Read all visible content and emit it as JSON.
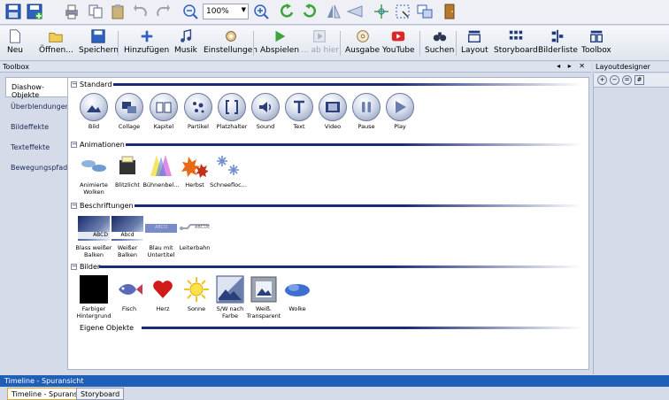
{
  "zoom_value": "100%",
  "toolbar": {
    "items": [
      {
        "label": "Neu",
        "icon": "new-document-icon"
      },
      {
        "label": "Öffnen...",
        "icon": "open-folder-icon"
      },
      {
        "label": "Speichern",
        "icon": "save-icon"
      },
      {
        "label": "Hinzufügen",
        "icon": "add-icon"
      },
      {
        "label": "Musik",
        "icon": "music-icon"
      },
      {
        "label": "Einstellungen",
        "icon": "settings-icon"
      },
      {
        "label": "Abspielen",
        "icon": "play-icon"
      },
      {
        "label": "... ab hier",
        "icon": "play-from-here-icon"
      },
      {
        "label": "Ausgabe",
        "icon": "output-disc-icon"
      },
      {
        "label": "YouTube",
        "icon": "youtube-icon"
      },
      {
        "label": "Suchen",
        "icon": "binoculars-icon"
      },
      {
        "label": "Layout",
        "icon": "layout-icon"
      },
      {
        "label": "Storyboard",
        "icon": "storyboard-icon"
      },
      {
        "label": "Bilderliste",
        "icon": "image-list-icon"
      },
      {
        "label": "Toolbox",
        "icon": "toolbox-icon"
      }
    ]
  },
  "toolbox_panel": {
    "title": "Toolbox",
    "controls": "◂ ▸ ✕"
  },
  "layout_panel": {
    "title": "Layoutdesigner"
  },
  "nav": [
    {
      "label": "Diashow-Objekte"
    },
    {
      "label": "Überblendungen"
    },
    {
      "label": "Bildeffekte"
    },
    {
      "label": "Texteffekte"
    },
    {
      "label": "Bewegungspfade"
    }
  ],
  "categories": {
    "standard": {
      "label": "Standard",
      "items": [
        {
          "label": "Bild"
        },
        {
          "label": "Collage"
        },
        {
          "label": "Kapitel"
        },
        {
          "label": "Partikel"
        },
        {
          "label": "Platzhalter"
        },
        {
          "label": "Sound"
        },
        {
          "label": "Text"
        },
        {
          "label": "Video"
        },
        {
          "label": "Pause"
        },
        {
          "label": "Play"
        }
      ]
    },
    "animationen": {
      "label": "Animationen",
      "items": [
        {
          "label": "Animierte Wolken"
        },
        {
          "label": "Blitzlicht"
        },
        {
          "label": "Bühnenbel..."
        },
        {
          "label": "Herbst"
        },
        {
          "label": "Schneefloc..."
        }
      ]
    },
    "beschriftungen": {
      "label": "Beschriftungen",
      "items": [
        {
          "label": "Blass weißer Balken",
          "sample": "ABCD"
        },
        {
          "label": "Weißer Balken",
          "sample": "Abcd"
        },
        {
          "label": "Blau mit Untertitel",
          "sample": "ABCD"
        },
        {
          "label": "Leiterbahn",
          "sample": "ABCDE"
        }
      ]
    },
    "bilder": {
      "label": "Bilder",
      "items": [
        {
          "label": "Farbiger Hintergrund"
        },
        {
          "label": "Fisch"
        },
        {
          "label": "Herz"
        },
        {
          "label": "Sonne"
        },
        {
          "label": "S/W nach Farbe"
        },
        {
          "label": "Weiß. Transparent"
        },
        {
          "label": "Wolke"
        }
      ]
    },
    "eigene": {
      "label": "Eigene Objekte"
    }
  },
  "timeline": {
    "title": "Timeline - Spuransicht"
  },
  "tabs": [
    {
      "label": "Timeline - Spuransicht"
    },
    {
      "label": "Storyboard"
    }
  ]
}
